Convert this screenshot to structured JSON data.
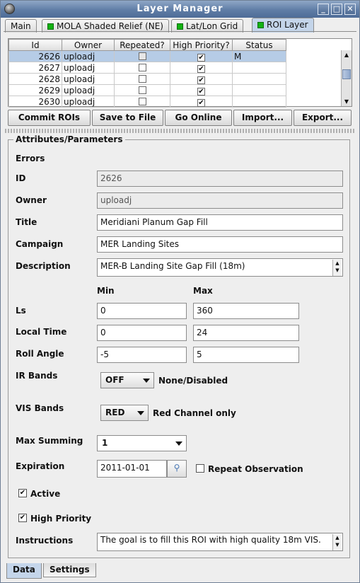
{
  "window": {
    "title": "Layer Manager",
    "min_label": "_",
    "max_label": "□",
    "close_label": "✕"
  },
  "tabs": [
    {
      "label": "Main"
    },
    {
      "label": "MOLA Shaded Relief (NE)"
    },
    {
      "label": "Lat/Lon Grid"
    },
    {
      "label": "ROI Layer",
      "selected": true
    }
  ],
  "table": {
    "headers": [
      "Id",
      "Owner",
      "Repeated?",
      "High Priority?",
      "Status"
    ],
    "rows": [
      {
        "id": "2626",
        "owner": "uploadj",
        "repeated": false,
        "high_priority": true,
        "status": "M",
        "selected": true
      },
      {
        "id": "2627",
        "owner": "uploadj",
        "repeated": false,
        "high_priority": true,
        "status": ""
      },
      {
        "id": "2628",
        "owner": "uploadj",
        "repeated": false,
        "high_priority": true,
        "status": ""
      },
      {
        "id": "2629",
        "owner": "uploadj",
        "repeated": false,
        "high_priority": true,
        "status": ""
      },
      {
        "id": "2630",
        "owner": "uploadj",
        "repeated": false,
        "high_priority": true,
        "status": ""
      }
    ]
  },
  "actions": {
    "commit": "Commit ROIs",
    "save": "Save to File",
    "online": "Go Online",
    "import": "Import...",
    "export": "Export..."
  },
  "attributes": {
    "section_title": "Attributes/Parameters",
    "errors_label": "Errors",
    "id_label": "ID",
    "id_value": "2626",
    "owner_label": "Owner",
    "owner_value": "uploadj",
    "title_label": "Title",
    "title_value": "Meridiani Planum Gap Fill",
    "campaign_label": "Campaign",
    "campaign_value": "MER Landing Sites",
    "description_label": "Description",
    "description_value": "MER-B Landing Site Gap Fill (18m)",
    "min_header": "Min",
    "max_header": "Max",
    "ls_label": "Ls",
    "ls_min": "0",
    "ls_max": "360",
    "local_time_label": "Local Time",
    "local_time_min": "0",
    "local_time_max": "24",
    "roll_label": "Roll Angle",
    "roll_min": "-5",
    "roll_max": "5",
    "ir_label": "IR Bands",
    "ir_value": "OFF",
    "ir_desc": "None/Disabled",
    "vis_label": "VIS Bands",
    "vis_value": "RED",
    "vis_desc": "Red Channel only",
    "max_summing_label": "Max Summing",
    "max_summing_value": "1",
    "expiration_label": "Expiration",
    "expiration_value": "2011-01-01",
    "repeat_label": "Repeat Observation",
    "repeat_checked": false,
    "active_label": "Active",
    "active_checked": true,
    "high_priority_label": "High Priority",
    "high_priority_checked": true,
    "instructions_label": "Instructions",
    "instructions_value": "The goal is to fill this ROI with high quality 18m VIS."
  },
  "bottom_tabs": [
    {
      "label": "Data",
      "selected": true
    },
    {
      "label": "Settings"
    }
  ],
  "colors": {
    "accent": "#5f7da6",
    "selection": "#b6cce6",
    "tab_indicator": "#12b312"
  }
}
